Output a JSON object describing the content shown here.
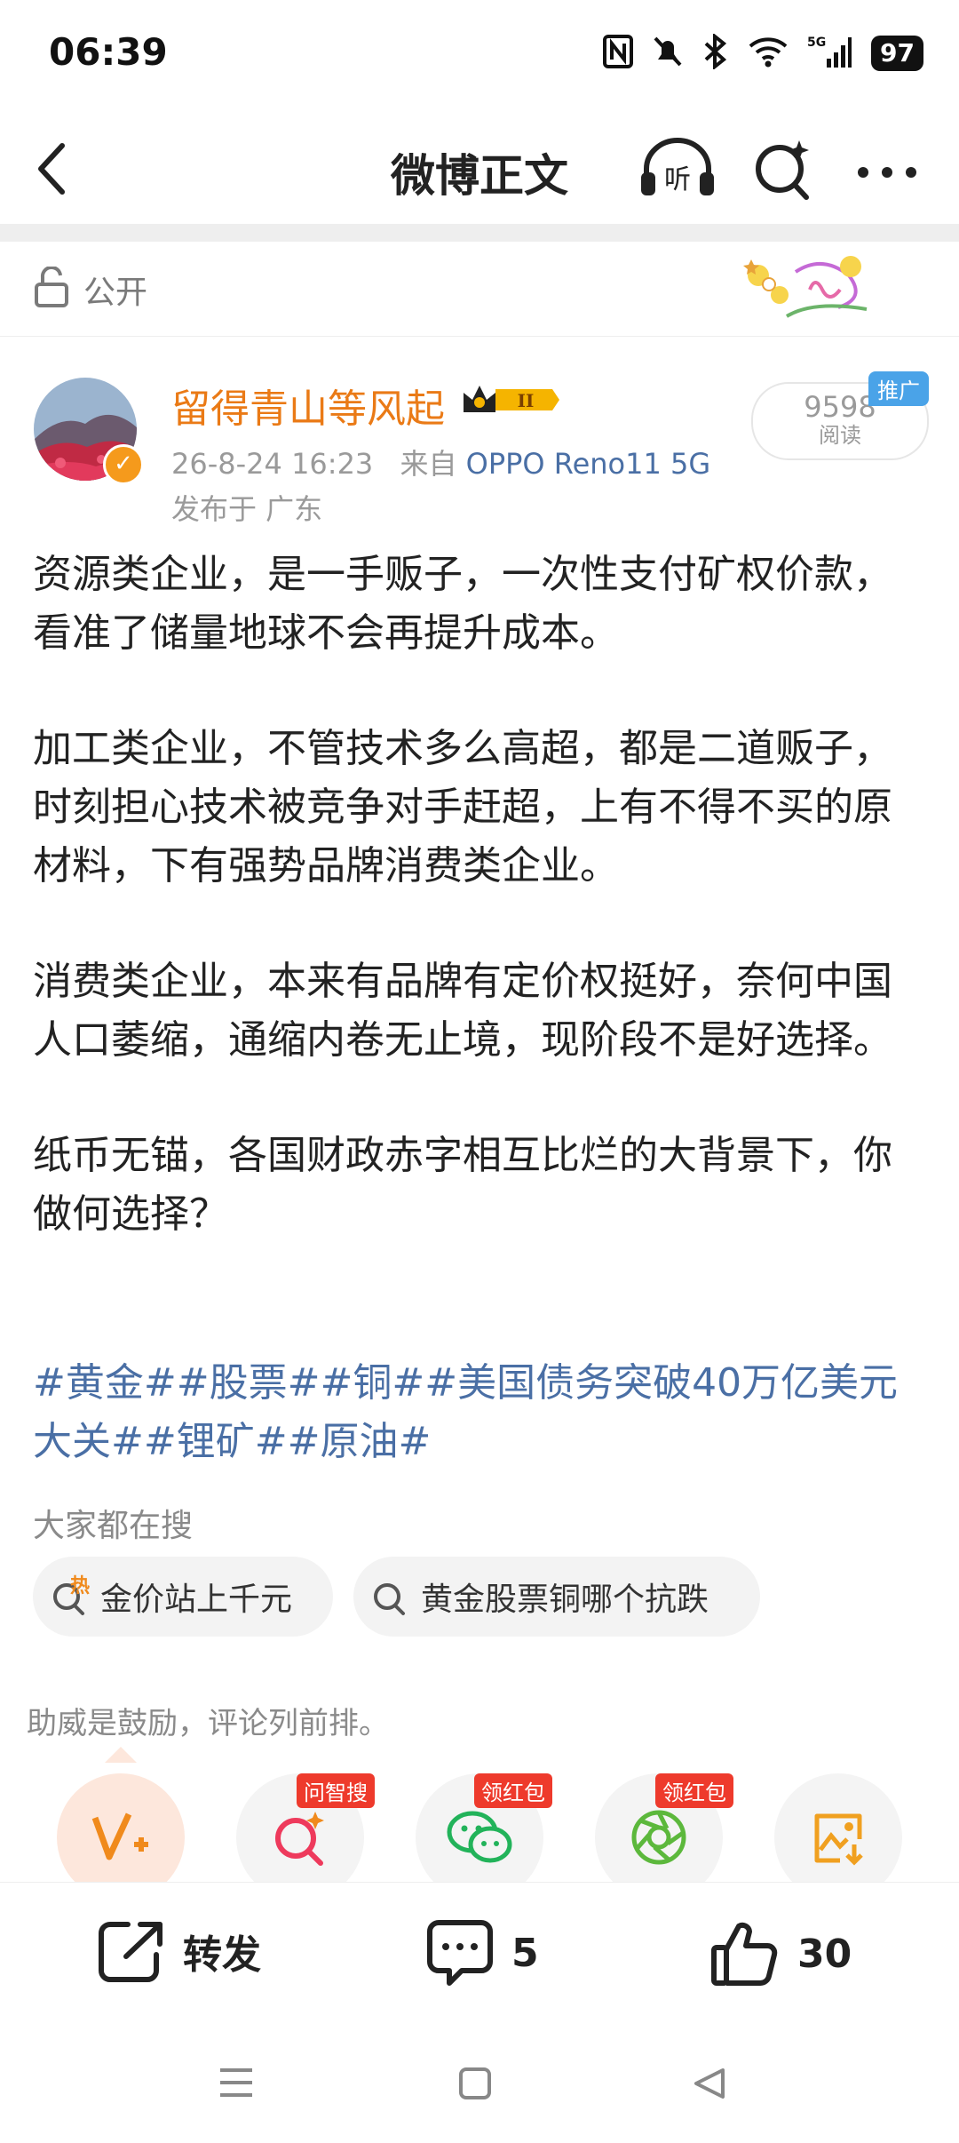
{
  "status_bar": {
    "time": "06:39",
    "battery": "97"
  },
  "nav": {
    "title": "微博正文"
  },
  "visibility": {
    "label": "公开"
  },
  "author": {
    "name": "留得青山等风起",
    "timestamp": "26-8-24 16:23",
    "source_prefix": "来自",
    "device": "OPPO Reno11 5G",
    "location": "发布于 广东"
  },
  "read": {
    "count": "9598",
    "label": "阅读",
    "promo": "推广"
  },
  "post": {
    "paragraphs": [
      "资源类企业，是一手贩子，一次性支付矿权价款，看准了储量地球不会再提升成本。",
      "加工类企业，不管技术多么高超，都是二道贩子，时刻担心技术被竞争对手赶超，上有不得不买的原材料，下有强势品牌消费类企业。",
      "消费类企业，本来有品牌有定价权挺好，奈何中国人口萎缩，通缩内卷无止境，现阶段不是好选择。",
      "纸币无锚，各国财政赤字相互比烂的大背景下，你做何选择？"
    ],
    "hashtags": "#黄金##股票##铜##美国债务突破40万亿美元大关##锂矿##原油#"
  },
  "search": {
    "header": "大家都在搜",
    "chips": [
      {
        "label": "金价站上千元",
        "hot": "热"
      },
      {
        "label": "黄金股票铜哪个抗跌"
      }
    ]
  },
  "support": {
    "note": "助威是鼓励，评论列前排。",
    "badges": [
      "问智搜",
      "领红包",
      "领红包"
    ]
  },
  "actions": {
    "repost": "转发",
    "comments": "5",
    "likes": "30"
  },
  "colors": {
    "brand_orange": "#ea7a16",
    "link_blue": "#4a6fa5",
    "badge_red": "#ee3a2c",
    "promo_blue": "#4aa3e8"
  }
}
